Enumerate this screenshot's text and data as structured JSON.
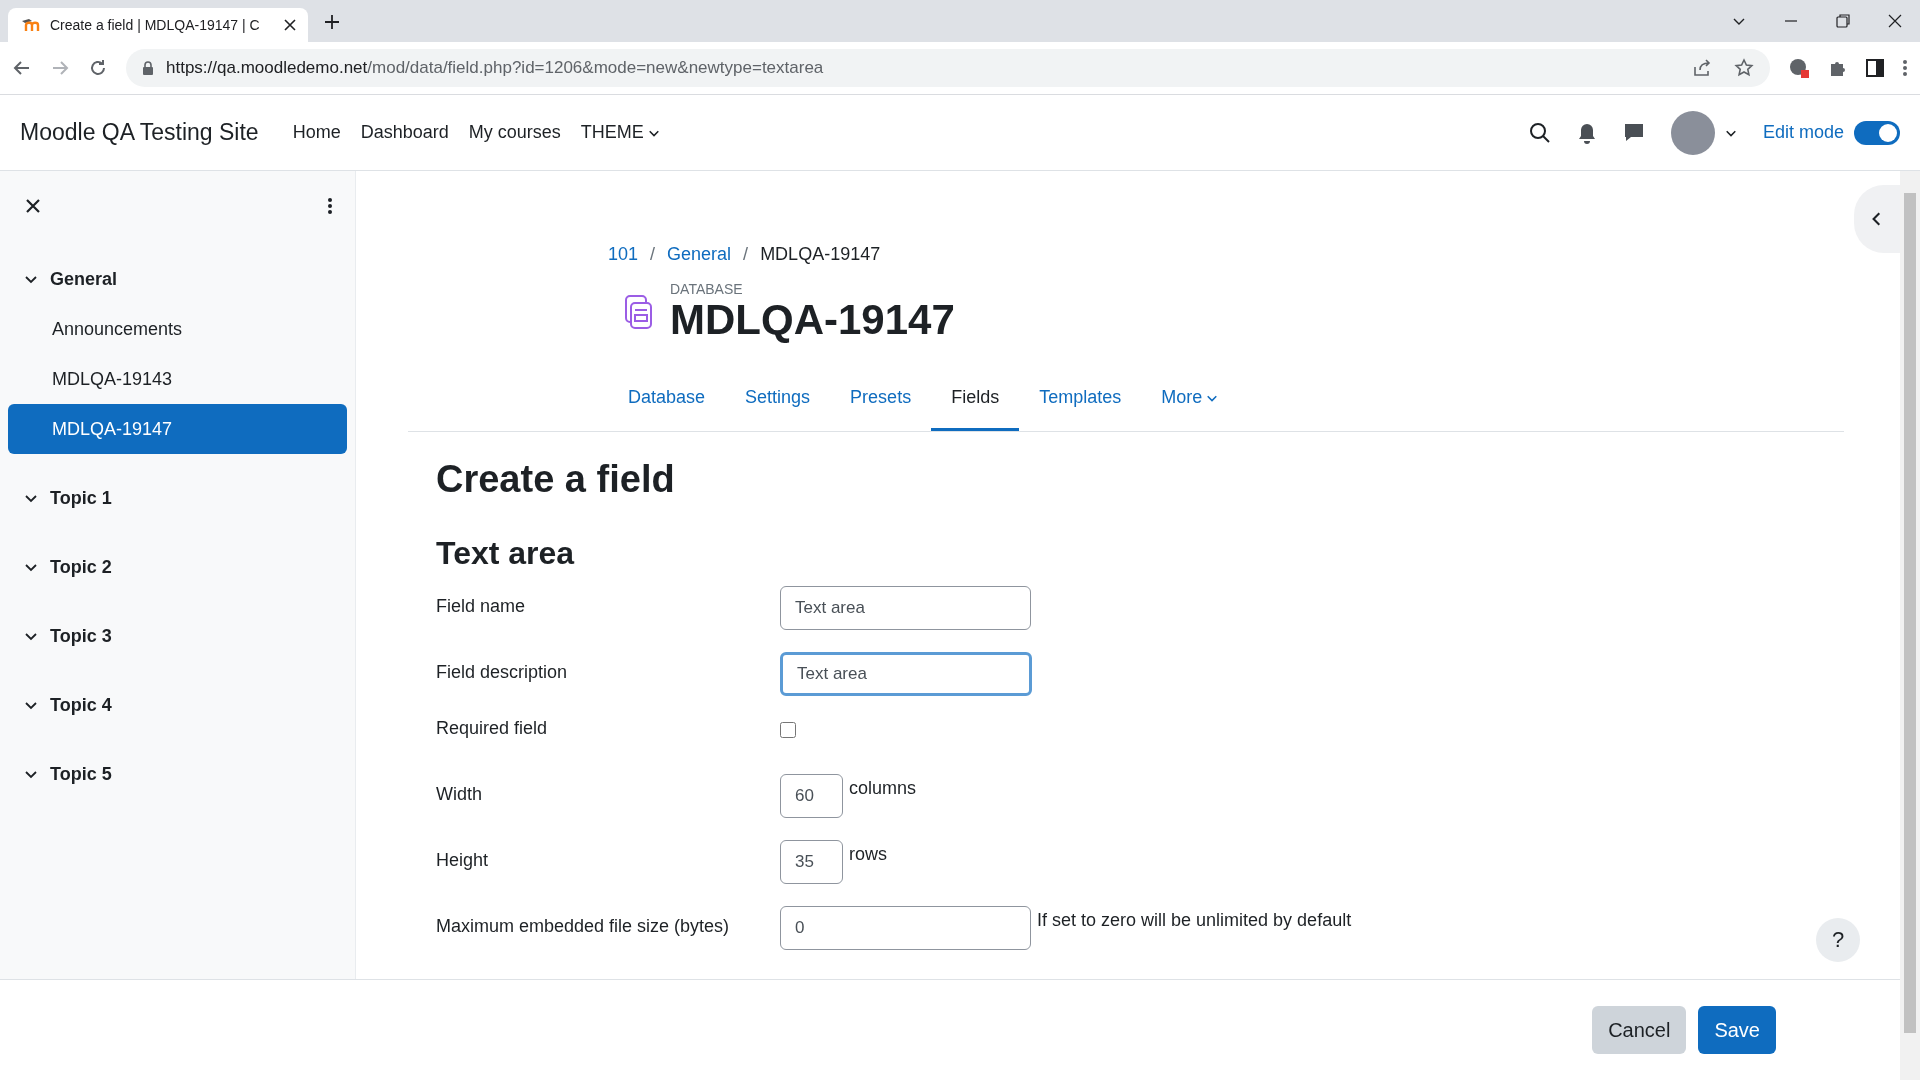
{
  "browser": {
    "tab_title": "Create a field | MDLQA-19147 | C",
    "url_host": "https://qa.moodledemo.net",
    "url_path": "/mod/data/field.php?id=1206&mode=new&newtype=textarea"
  },
  "navbar": {
    "site_name": "Moodle QA Testing Site",
    "links": [
      {
        "label": "Home",
        "dropdown": false
      },
      {
        "label": "Dashboard",
        "dropdown": false
      },
      {
        "label": "My courses",
        "dropdown": false
      },
      {
        "label": "THEME",
        "dropdown": true
      }
    ],
    "edit_mode_label": "Edit mode",
    "edit_mode_on": true
  },
  "sidebar": {
    "sections": [
      {
        "title": "General",
        "expanded": true,
        "items": [
          {
            "label": "Announcements",
            "selected": false
          },
          {
            "label": "MDLQA-19143",
            "selected": false
          },
          {
            "label": "MDLQA-19147",
            "selected": true
          }
        ]
      },
      {
        "title": "Topic 1",
        "expanded": true
      },
      {
        "title": "Topic 2",
        "expanded": true
      },
      {
        "title": "Topic 3",
        "expanded": true
      },
      {
        "title": "Topic 4",
        "expanded": true
      },
      {
        "title": "Topic 5",
        "expanded": true
      }
    ]
  },
  "breadcrumb": [
    {
      "label": "101",
      "link": true
    },
    {
      "separator_before": "/",
      "label": "General",
      "link": true
    },
    {
      "separator_before": "/",
      "label": "MDLQA-19147",
      "link": false
    }
  ],
  "activity": {
    "type_label": "DATABASE",
    "title": "MDLQA-19147"
  },
  "tabs": [
    {
      "label": "Database",
      "selected": false,
      "dropdown": false
    },
    {
      "label": "Settings",
      "selected": false,
      "dropdown": false
    },
    {
      "label": "Presets",
      "selected": false,
      "dropdown": false
    },
    {
      "label": "Fields",
      "selected": true,
      "dropdown": false
    },
    {
      "label": "Templates",
      "selected": false,
      "dropdown": false
    },
    {
      "label": "More",
      "selected": false,
      "dropdown": true
    }
  ],
  "page_title": "Create a field",
  "section_title": "Text area",
  "form": [
    {
      "kind": "text",
      "label": "Field name",
      "value": "Text area",
      "focused": false
    },
    {
      "kind": "text",
      "label": "Field description",
      "value": "Text area",
      "focused": true
    },
    {
      "kind": "checkbox",
      "label": "Required field",
      "checked": false
    },
    {
      "kind": "number",
      "label": "Width",
      "value": "60",
      "suffix": "columns"
    },
    {
      "kind": "number",
      "label": "Height",
      "value": "35",
      "suffix": "rows"
    },
    {
      "kind": "note",
      "label": "Maximum embedded file size (bytes)",
      "value": "0",
      "suffix": "If set to zero will be unlimited by default"
    }
  ],
  "footer": {
    "buttons": [
      {
        "label": "Cancel",
        "primary": false
      },
      {
        "label": "Save",
        "primary": true
      }
    ]
  },
  "help_button": "?"
}
